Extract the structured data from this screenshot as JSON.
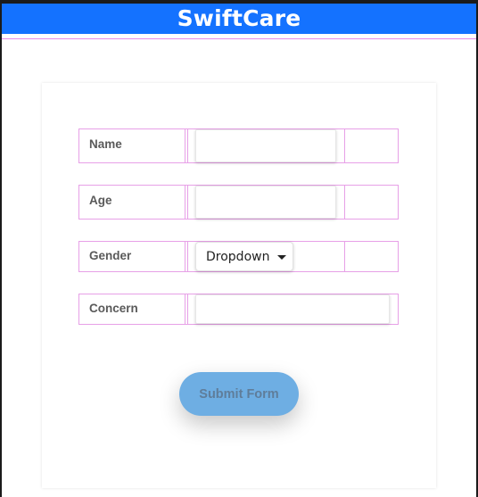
{
  "app": {
    "title": "SwiftCare"
  },
  "form": {
    "fields": [
      {
        "label": "Name",
        "value": ""
      },
      {
        "label": "Age",
        "value": ""
      },
      {
        "label": "Gender",
        "value": "Dropdown"
      },
      {
        "label": "Concern",
        "value": ""
      }
    ],
    "submit_label": "Submit Form"
  },
  "colors": {
    "header_bg": "#1472ff",
    "submit_bg": "#6eaee3",
    "grid_lines": "#e7a0e7"
  }
}
